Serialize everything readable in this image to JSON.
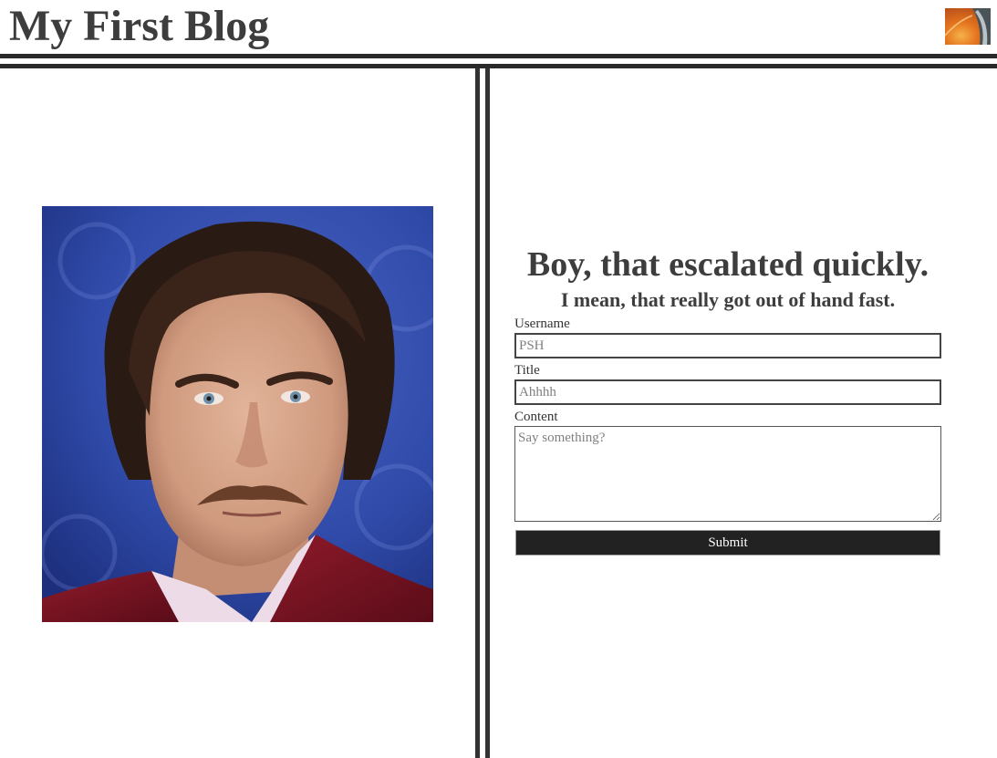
{
  "header": {
    "site_title": "My First Blog",
    "logo_icon": "blog-logo-icon"
  },
  "hero_image": {
    "icon": "portrait-photo"
  },
  "form": {
    "headline": "Boy, that escalated quickly.",
    "subheadline": "I mean, that really got out of hand fast.",
    "username_label": "Username",
    "username_placeholder": "PSH",
    "title_label": "Title",
    "title_placeholder": "Ahhhh",
    "content_label": "Content",
    "content_placeholder": "Say something?",
    "submit_label": "Submit"
  },
  "colors": {
    "rule": "#2a2a2a",
    "title_text": "#3d3d3d",
    "submit_bg": "#222222",
    "photo_bg": "#2f4aa8"
  }
}
